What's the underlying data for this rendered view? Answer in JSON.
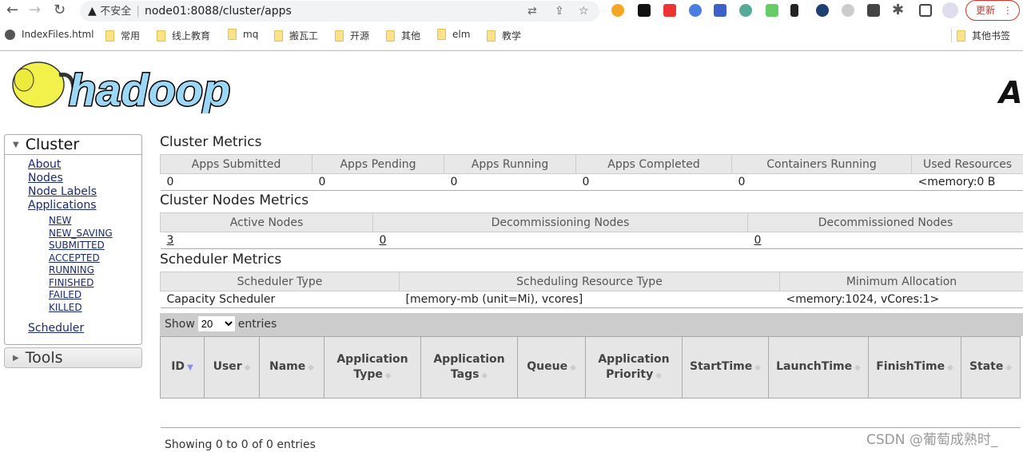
{
  "browser": {
    "security_label": "不安全",
    "url": "node01:8088/cluster/apps",
    "update_label": "更新",
    "bookmarks": [
      "IndexFiles.html",
      "常用",
      "线上教育",
      "mq",
      "搬瓦工",
      "开源",
      "其他",
      "elm",
      "教学"
    ],
    "other_bookmarks": "其他书签"
  },
  "logo_text": "hadoop",
  "sidebar": {
    "title": "Cluster",
    "links": [
      "About",
      "Nodes",
      "Node Labels",
      "Applications"
    ],
    "app_states": [
      "NEW",
      "NEW_SAVING",
      "SUBMITTED",
      "ACCEPTED",
      "RUNNING",
      "FINISHED",
      "FAILED",
      "KILLED"
    ],
    "scheduler": "Scheduler",
    "tools": "Tools"
  },
  "cluster_metrics": {
    "title": "Cluster Metrics",
    "headers": [
      "Apps Submitted",
      "Apps Pending",
      "Apps Running",
      "Apps Completed",
      "Containers Running",
      "Used Resources"
    ],
    "values": [
      "0",
      "0",
      "0",
      "0",
      "0",
      "<memory:0 B"
    ]
  },
  "nodes_metrics": {
    "title": "Cluster Nodes Metrics",
    "headers": [
      "Active Nodes",
      "Decommissioning Nodes",
      "Decommissioned Nodes"
    ],
    "values": [
      "3",
      "0",
      "0"
    ]
  },
  "scheduler_metrics": {
    "title": "Scheduler Metrics",
    "headers": [
      "Scheduler Type",
      "Scheduling Resource Type",
      "Minimum Allocation"
    ],
    "values": [
      "Capacity Scheduler",
      "[memory-mb (unit=Mi), vcores]",
      "<memory:1024, vCores:1>"
    ]
  },
  "apps": {
    "show": "Show",
    "entries": "entries",
    "page_size": "20",
    "columns": [
      "ID",
      "User",
      "Name",
      "Application Type",
      "Application Tags",
      "Queue",
      "Application Priority",
      "StartTime",
      "LaunchTime",
      "FinishTime",
      "State"
    ],
    "footer": "Showing 0 to 0 of 0 entries"
  },
  "watermark": "CSDN @葡萄成熟时_"
}
